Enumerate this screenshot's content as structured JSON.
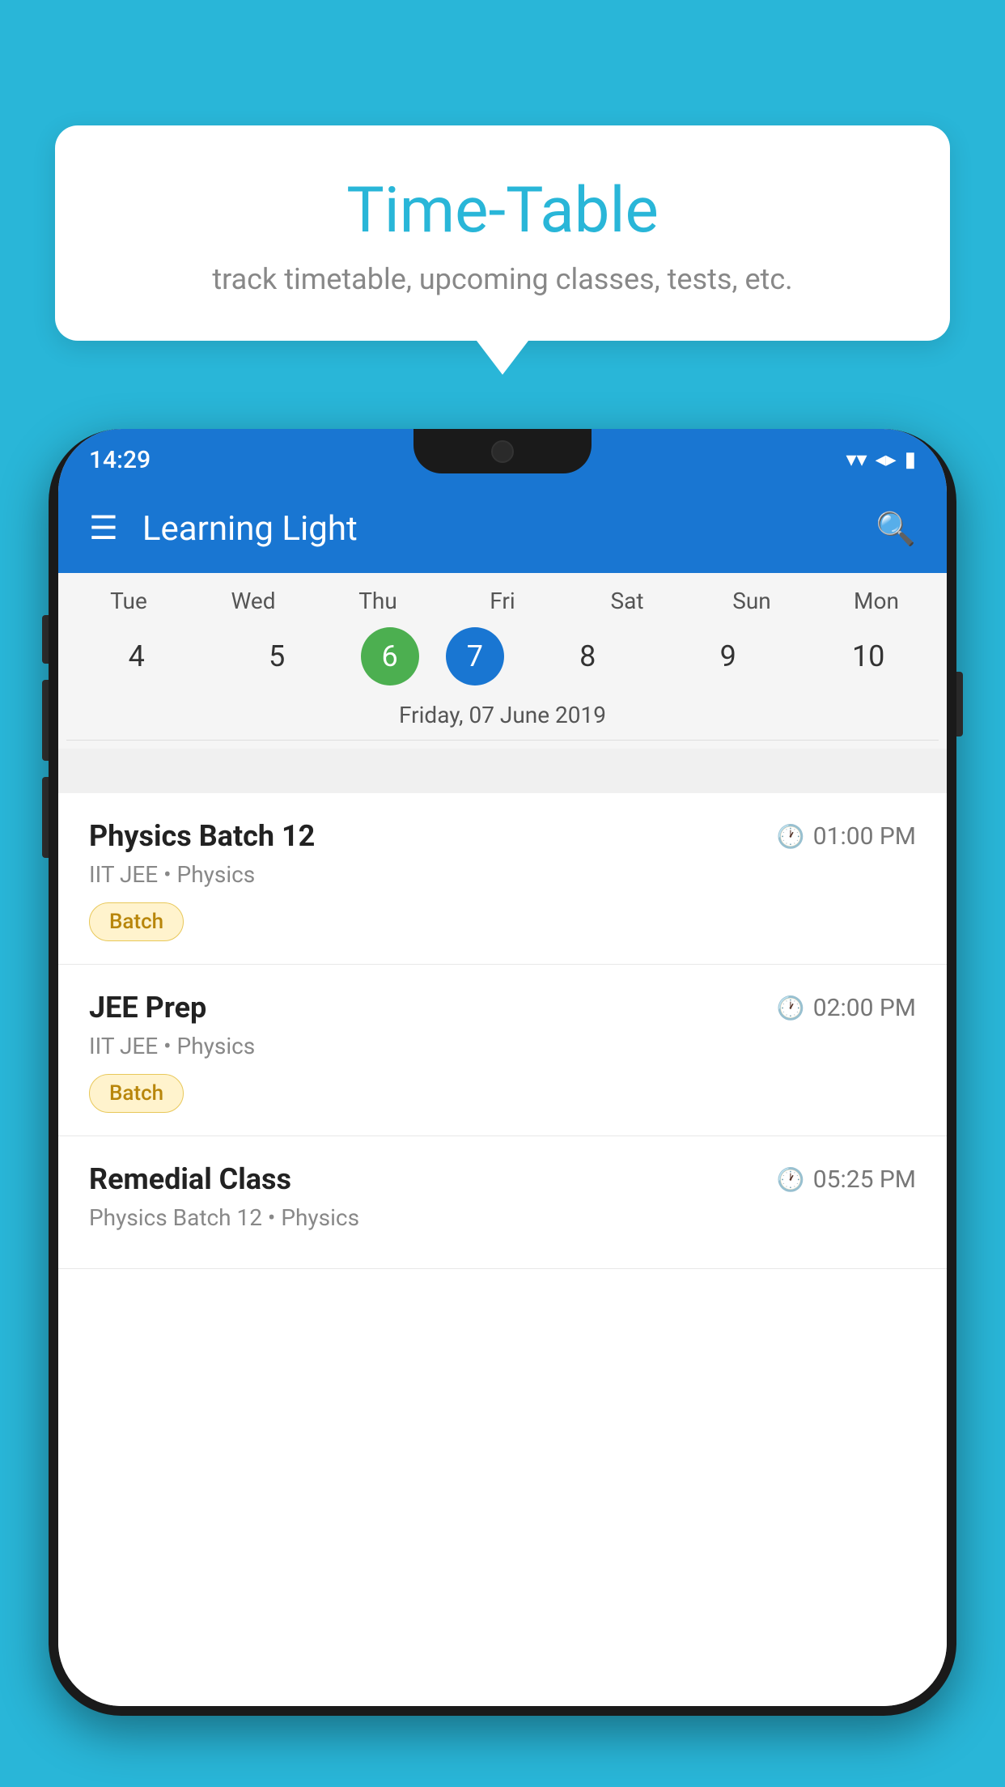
{
  "background_color": "#29b6d8",
  "tooltip": {
    "title": "Time-Table",
    "subtitle": "track timetable, upcoming classes, tests, etc."
  },
  "app": {
    "status_time": "14:29",
    "title": "Learning Light"
  },
  "calendar": {
    "days": [
      {
        "label": "Tue",
        "num": "4"
      },
      {
        "label": "Wed",
        "num": "5"
      },
      {
        "label": "Thu",
        "num": "6",
        "state": "today"
      },
      {
        "label": "Fri",
        "num": "7",
        "state": "selected"
      },
      {
        "label": "Sat",
        "num": "8"
      },
      {
        "label": "Sun",
        "num": "9"
      },
      {
        "label": "Mon",
        "num": "10"
      }
    ],
    "selected_date": "Friday, 07 June 2019"
  },
  "schedule": [
    {
      "class_name": "Physics Batch 12",
      "time": "01:00 PM",
      "subject": "IIT JEE • Physics",
      "tag": "Batch"
    },
    {
      "class_name": "JEE Prep",
      "time": "02:00 PM",
      "subject": "IIT JEE • Physics",
      "tag": "Batch"
    },
    {
      "class_name": "Remedial Class",
      "time": "05:25 PM",
      "subject": "Physics Batch 12 • Physics",
      "tag": ""
    }
  ],
  "icons": {
    "hamburger": "≡",
    "search": "🔍",
    "clock": "🕐"
  }
}
